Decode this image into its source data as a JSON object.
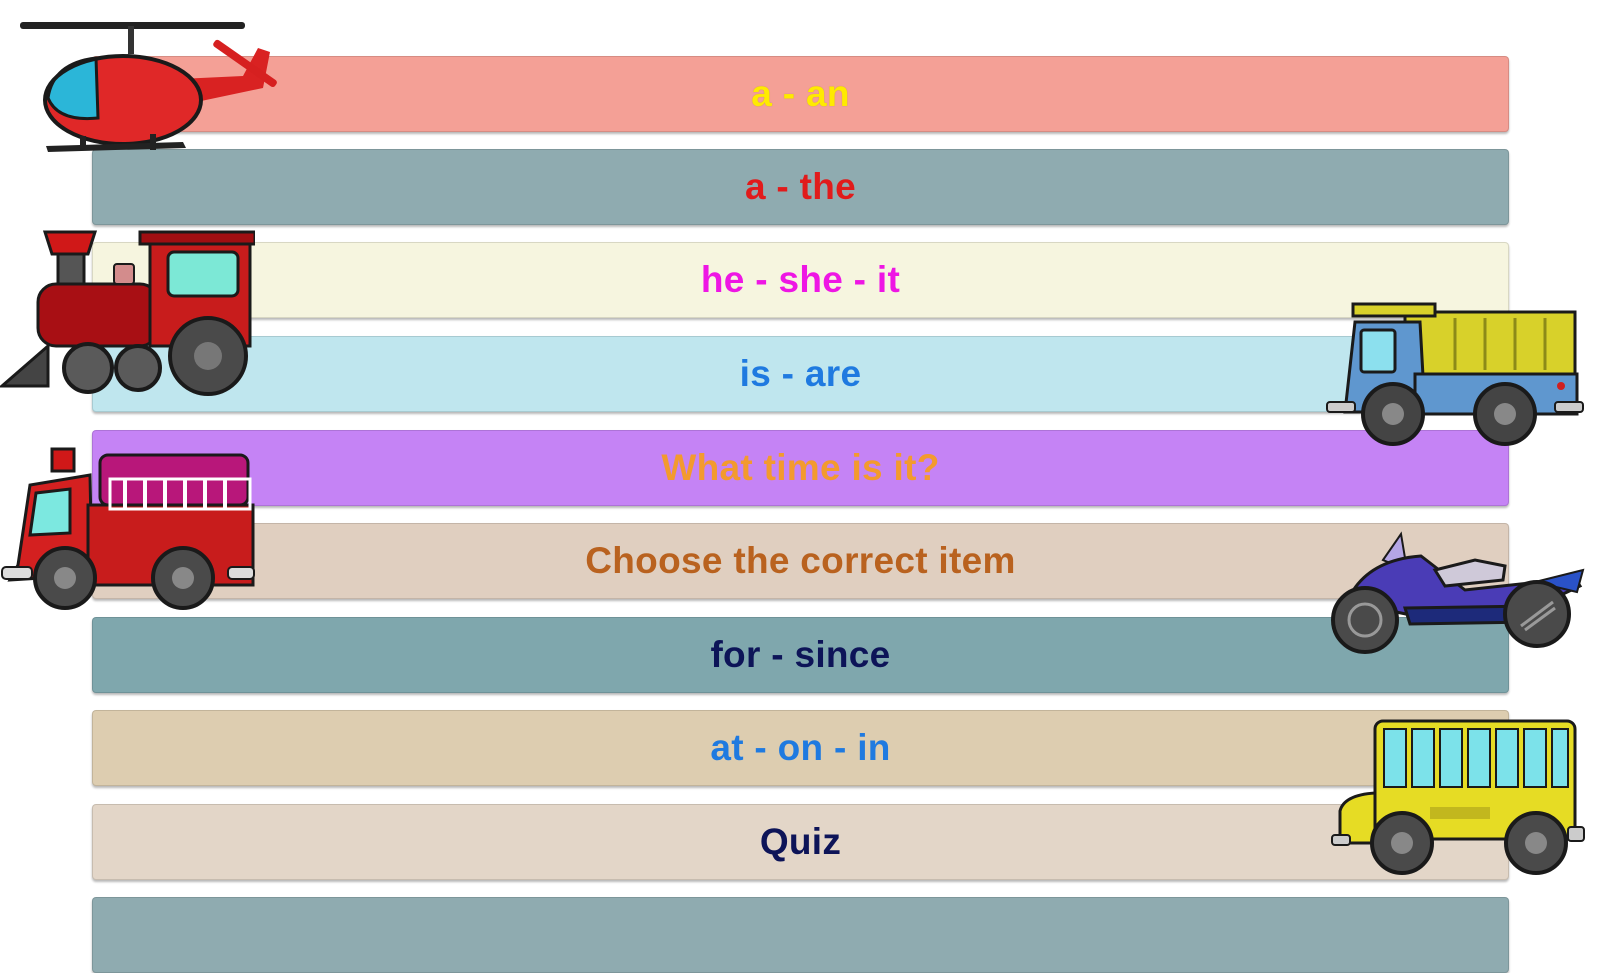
{
  "menu": {
    "items": [
      {
        "label": "a - an",
        "bg": "#f4a096",
        "color": "#ffea00"
      },
      {
        "label": "a - the",
        "bg": "#8fabb0",
        "color": "#e11b1b"
      },
      {
        "label": "he - she - it",
        "bg": "#f6f5df",
        "color": "#ee16e4"
      },
      {
        "label": "is - are",
        "bg": "#bfe6ee",
        "color": "#1f7ae0"
      },
      {
        "label": "What time is it?",
        "bg": "#c583f5",
        "color": "#f39a2e"
      },
      {
        "label": "Choose the correct item",
        "bg": "#e0cfc0",
        "color": "#b9621f"
      },
      {
        "label": "for - since",
        "bg": "#7fa7ad",
        "color": "#0d1458"
      },
      {
        "label": "at - on - in",
        "bg": "#ddcdb0",
        "color": "#1f7ae0"
      },
      {
        "label": "Quiz",
        "bg": "#e3d6c8",
        "color": "#0d1458"
      },
      {
        "label": "",
        "bg": "#8fabb0",
        "color": "#0d1458"
      }
    ]
  },
  "vehicles": [
    "helicopter-icon",
    "train-icon",
    "fire-truck-icon",
    "dump-truck-icon",
    "motorcycle-icon",
    "school-bus-icon"
  ]
}
